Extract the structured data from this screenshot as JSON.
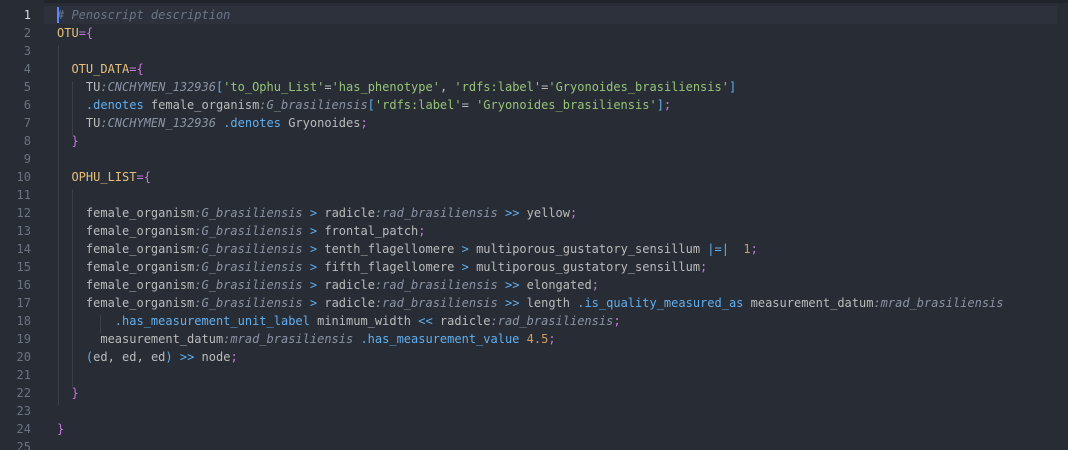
{
  "editor": {
    "active_line": 1,
    "lines": [
      {
        "n": "1",
        "tokens": [
          {
            "t": "# Penoscript description",
            "c": "comment"
          }
        ]
      },
      {
        "n": "2",
        "tokens": [
          {
            "t": "OTU",
            "c": "head"
          },
          {
            "t": "=",
            "c": "punc"
          },
          {
            "t": "{",
            "c": "punc"
          }
        ]
      },
      {
        "n": "3",
        "tokens": []
      },
      {
        "n": "4",
        "tokens": [
          {
            "t": "  ",
            "c": "plain"
          },
          {
            "t": "OTU_DATA",
            "c": "head"
          },
          {
            "t": "=",
            "c": "punc"
          },
          {
            "t": "{",
            "c": "punc"
          }
        ]
      },
      {
        "n": "5",
        "tokens": [
          {
            "t": "    TU",
            "c": "ident"
          },
          {
            "t": ":CNCHYMEN_132936",
            "c": "type"
          },
          {
            "t": "[",
            "c": "bracket"
          },
          {
            "t": "'to_Ophu_List'",
            "c": "string"
          },
          {
            "t": "=",
            "c": "plain"
          },
          {
            "t": "'has_phenotype'",
            "c": "string"
          },
          {
            "t": ", ",
            "c": "plain"
          },
          {
            "t": "'rdfs:label'",
            "c": "string"
          },
          {
            "t": "=",
            "c": "plain"
          },
          {
            "t": "'Gryonoides_brasiliensis'",
            "c": "string"
          },
          {
            "t": "]",
            "c": "bracket"
          }
        ]
      },
      {
        "n": "6",
        "tokens": [
          {
            "t": "    ",
            "c": "plain"
          },
          {
            "t": ".denotes",
            "c": "method"
          },
          {
            "t": " female_organism",
            "c": "ident"
          },
          {
            "t": ":G_brasiliensis",
            "c": "type"
          },
          {
            "t": "[",
            "c": "bracket"
          },
          {
            "t": "'rdfs:label'",
            "c": "string"
          },
          {
            "t": "= ",
            "c": "plain"
          },
          {
            "t": "'Gryonoides_brasiliensis'",
            "c": "string"
          },
          {
            "t": "]",
            "c": "bracket"
          },
          {
            "t": ";",
            "c": "punc"
          }
        ]
      },
      {
        "n": "7",
        "tokens": [
          {
            "t": "    TU",
            "c": "ident"
          },
          {
            "t": ":CNCHYMEN_132936",
            "c": "type"
          },
          {
            "t": " ",
            "c": "plain"
          },
          {
            "t": ".denotes",
            "c": "method"
          },
          {
            "t": " Gryonoides",
            "c": "ident"
          },
          {
            "t": ";",
            "c": "punc"
          }
        ]
      },
      {
        "n": "8",
        "tokens": [
          {
            "t": "  ",
            "c": "plain"
          },
          {
            "t": "}",
            "c": "punc"
          }
        ]
      },
      {
        "n": "9",
        "tokens": []
      },
      {
        "n": "10",
        "tokens": [
          {
            "t": "  ",
            "c": "plain"
          },
          {
            "t": "OPHU_LIST",
            "c": "head"
          },
          {
            "t": "=",
            "c": "punc"
          },
          {
            "t": "{",
            "c": "punc"
          }
        ]
      },
      {
        "n": "11",
        "tokens": []
      },
      {
        "n": "12",
        "tokens": [
          {
            "t": "    female_organism",
            "c": "ident"
          },
          {
            "t": ":G_brasiliensis",
            "c": "type"
          },
          {
            "t": " ",
            "c": "plain"
          },
          {
            "t": ">",
            "c": "op"
          },
          {
            "t": " radicle",
            "c": "ident"
          },
          {
            "t": ":rad_brasiliensis",
            "c": "type"
          },
          {
            "t": " ",
            "c": "plain"
          },
          {
            "t": ">>",
            "c": "op"
          },
          {
            "t": " yellow",
            "c": "ident"
          },
          {
            "t": ";",
            "c": "punc"
          }
        ]
      },
      {
        "n": "13",
        "tokens": [
          {
            "t": "    female_organism",
            "c": "ident"
          },
          {
            "t": ":G_brasiliensis",
            "c": "type"
          },
          {
            "t": " ",
            "c": "plain"
          },
          {
            "t": ">",
            "c": "op"
          },
          {
            "t": " frontal_patch",
            "c": "ident"
          },
          {
            "t": ";",
            "c": "punc"
          }
        ]
      },
      {
        "n": "14",
        "tokens": [
          {
            "t": "    female_organism",
            "c": "ident"
          },
          {
            "t": ":G_brasiliensis",
            "c": "type"
          },
          {
            "t": " ",
            "c": "plain"
          },
          {
            "t": ">",
            "c": "op"
          },
          {
            "t": " tenth_flagellomere ",
            "c": "ident"
          },
          {
            "t": ">",
            "c": "op"
          },
          {
            "t": " multiporous_gustatory_sensillum ",
            "c": "ident"
          },
          {
            "t": "|=|",
            "c": "op"
          },
          {
            "t": "  ",
            "c": "plain"
          },
          {
            "t": "1",
            "c": "num"
          },
          {
            "t": ";",
            "c": "punc"
          }
        ]
      },
      {
        "n": "15",
        "tokens": [
          {
            "t": "    female_organism",
            "c": "ident"
          },
          {
            "t": ":G_brasiliensis",
            "c": "type"
          },
          {
            "t": " ",
            "c": "plain"
          },
          {
            "t": ">",
            "c": "op"
          },
          {
            "t": " fifth_flagellomere ",
            "c": "ident"
          },
          {
            "t": ">",
            "c": "op"
          },
          {
            "t": " multiporous_gustatory_sensillum",
            "c": "ident"
          },
          {
            "t": ";",
            "c": "punc"
          }
        ]
      },
      {
        "n": "16",
        "tokens": [
          {
            "t": "    female_organism",
            "c": "ident"
          },
          {
            "t": ":G_brasiliensis",
            "c": "type"
          },
          {
            "t": " ",
            "c": "plain"
          },
          {
            "t": ">",
            "c": "op"
          },
          {
            "t": " radicle",
            "c": "ident"
          },
          {
            "t": ":rad_brasiliensis",
            "c": "type"
          },
          {
            "t": " ",
            "c": "plain"
          },
          {
            "t": ">>",
            "c": "op"
          },
          {
            "t": " elongated",
            "c": "ident"
          },
          {
            "t": ";",
            "c": "punc"
          }
        ]
      },
      {
        "n": "17",
        "tokens": [
          {
            "t": "    female_organism",
            "c": "ident"
          },
          {
            "t": ":G_brasiliensis",
            "c": "type"
          },
          {
            "t": " ",
            "c": "plain"
          },
          {
            "t": ">",
            "c": "op"
          },
          {
            "t": " radicle",
            "c": "ident"
          },
          {
            "t": ":rad_brasiliensis",
            "c": "type"
          },
          {
            "t": " ",
            "c": "plain"
          },
          {
            "t": ">>",
            "c": "op"
          },
          {
            "t": " length ",
            "c": "ident"
          },
          {
            "t": ".is_quality_measured_as",
            "c": "method"
          },
          {
            "t": " measurement_datum",
            "c": "ident"
          },
          {
            "t": ":mrad_brasiliensis",
            "c": "type"
          }
        ]
      },
      {
        "n": "18",
        "tokens": [
          {
            "t": "        ",
            "c": "plain"
          },
          {
            "t": ".has_measurement_unit_label",
            "c": "method"
          },
          {
            "t": " minimum_width ",
            "c": "ident"
          },
          {
            "t": "<<",
            "c": "op"
          },
          {
            "t": " radicle",
            "c": "ident"
          },
          {
            "t": ":rad_brasiliensis",
            "c": "type"
          },
          {
            "t": ";",
            "c": "punc"
          }
        ]
      },
      {
        "n": "19",
        "tokens": [
          {
            "t": "      measurement_datum",
            "c": "ident"
          },
          {
            "t": ":mrad_brasiliensis",
            "c": "type"
          },
          {
            "t": " ",
            "c": "plain"
          },
          {
            "t": ".has_measurement_value",
            "c": "method"
          },
          {
            "t": " ",
            "c": "plain"
          },
          {
            "t": "4.5",
            "c": "num"
          },
          {
            "t": ";",
            "c": "punc"
          }
        ]
      },
      {
        "n": "20",
        "tokens": [
          {
            "t": "    ",
            "c": "plain"
          },
          {
            "t": "(",
            "c": "bracket"
          },
          {
            "t": "ed, ed, ed",
            "c": "ident"
          },
          {
            "t": ")",
            "c": "bracket"
          },
          {
            "t": " ",
            "c": "plain"
          },
          {
            "t": ">>",
            "c": "op"
          },
          {
            "t": " node",
            "c": "ident"
          },
          {
            "t": ";",
            "c": "punc"
          }
        ]
      },
      {
        "n": "21",
        "tokens": []
      },
      {
        "n": "22",
        "tokens": [
          {
            "t": "  ",
            "c": "plain"
          },
          {
            "t": "}",
            "c": "punc"
          }
        ]
      },
      {
        "n": "23",
        "tokens": []
      },
      {
        "n": "24",
        "tokens": [
          {
            "t": "}",
            "c": "punc"
          }
        ]
      },
      {
        "n": "25",
        "tokens": []
      }
    ]
  }
}
